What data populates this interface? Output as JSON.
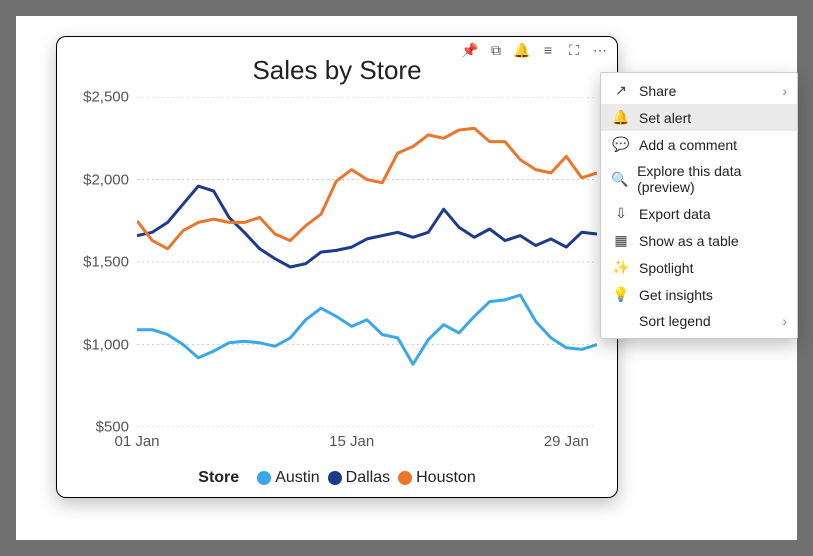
{
  "chart_data": {
    "type": "line",
    "title": "Sales by Store",
    "xlabel": "",
    "ylabel": "",
    "ylim": [
      500,
      2500
    ],
    "xlim": [
      1,
      31
    ],
    "x": [
      1,
      2,
      3,
      4,
      5,
      6,
      7,
      8,
      9,
      10,
      11,
      12,
      13,
      14,
      15,
      16,
      17,
      18,
      19,
      20,
      21,
      22,
      23,
      24,
      25,
      26,
      27,
      28,
      29,
      30,
      31
    ],
    "series": [
      {
        "name": "Austin",
        "color": "#39A7E8",
        "values": [
          1090,
          1090,
          1060,
          1000,
          920,
          960,
          1010,
          1020,
          1010,
          990,
          1040,
          1150,
          1220,
          1170,
          1110,
          1150,
          1060,
          1040,
          880,
          1030,
          1120,
          1070,
          1170,
          1260,
          1270,
          1300,
          1140,
          1040,
          980,
          970,
          1000
        ]
      },
      {
        "name": "Dallas",
        "color": "#1E3A8A",
        "values": [
          1660,
          1680,
          1740,
          1850,
          1960,
          1930,
          1770,
          1680,
          1580,
          1520,
          1470,
          1490,
          1560,
          1570,
          1590,
          1640,
          1660,
          1680,
          1650,
          1680,
          1820,
          1710,
          1650,
          1700,
          1630,
          1660,
          1600,
          1640,
          1590,
          1680,
          1670
        ]
      },
      {
        "name": "Houston",
        "color": "#E9762B",
        "values": [
          1750,
          1630,
          1580,
          1690,
          1740,
          1760,
          1740,
          1740,
          1770,
          1670,
          1630,
          1720,
          1790,
          1990,
          2060,
          2000,
          1980,
          2160,
          2200,
          2270,
          2250,
          2300,
          2310,
          2230,
          2230,
          2120,
          2060,
          2040,
          2140,
          2010,
          2040
        ]
      }
    ],
    "y_ticks": [
      500,
      1000,
      1500,
      2000,
      2500
    ],
    "x_tick_labels": [
      {
        "at": 1,
        "label": "01 Jan"
      },
      {
        "at": 15,
        "label": "15 Jan"
      },
      {
        "at": 29,
        "label": "29 Jan"
      }
    ],
    "legend_title": "Store"
  },
  "toolbar_icons": [
    {
      "name": "pin-icon",
      "glyph": "📌"
    },
    {
      "name": "copy-icon",
      "glyph": "⧉"
    },
    {
      "name": "bell-icon",
      "glyph": "🔔"
    },
    {
      "name": "filter-icon",
      "glyph": "≡"
    },
    {
      "name": "focus-icon",
      "glyph": "⛶"
    },
    {
      "name": "more-icon",
      "glyph": "⋯"
    }
  ],
  "context_menu": {
    "items": [
      {
        "icon": "share-icon",
        "glyph": "↗",
        "label": "Share",
        "submenu": true,
        "highlight": false
      },
      {
        "icon": "bell-icon",
        "glyph": "🔔",
        "label": "Set alert",
        "submenu": false,
        "highlight": true
      },
      {
        "icon": "comment-icon",
        "glyph": "💬",
        "label": "Add a comment",
        "submenu": false,
        "highlight": false
      },
      {
        "icon": "explore-icon",
        "glyph": "🔍",
        "label": "Explore this data (preview)",
        "submenu": false,
        "highlight": false
      },
      {
        "icon": "export-icon",
        "glyph": "⇩",
        "label": "Export data",
        "submenu": false,
        "highlight": false
      },
      {
        "icon": "table-icon",
        "glyph": "▦",
        "label": "Show as a table",
        "submenu": false,
        "highlight": false
      },
      {
        "icon": "spotlight-icon",
        "glyph": "✨",
        "label": "Spotlight",
        "submenu": false,
        "highlight": false
      },
      {
        "icon": "insights-icon",
        "glyph": "💡",
        "label": "Get insights",
        "submenu": false,
        "highlight": false
      },
      {
        "icon": "",
        "glyph": "",
        "label": "Sort legend",
        "submenu": true,
        "highlight": false
      }
    ]
  }
}
